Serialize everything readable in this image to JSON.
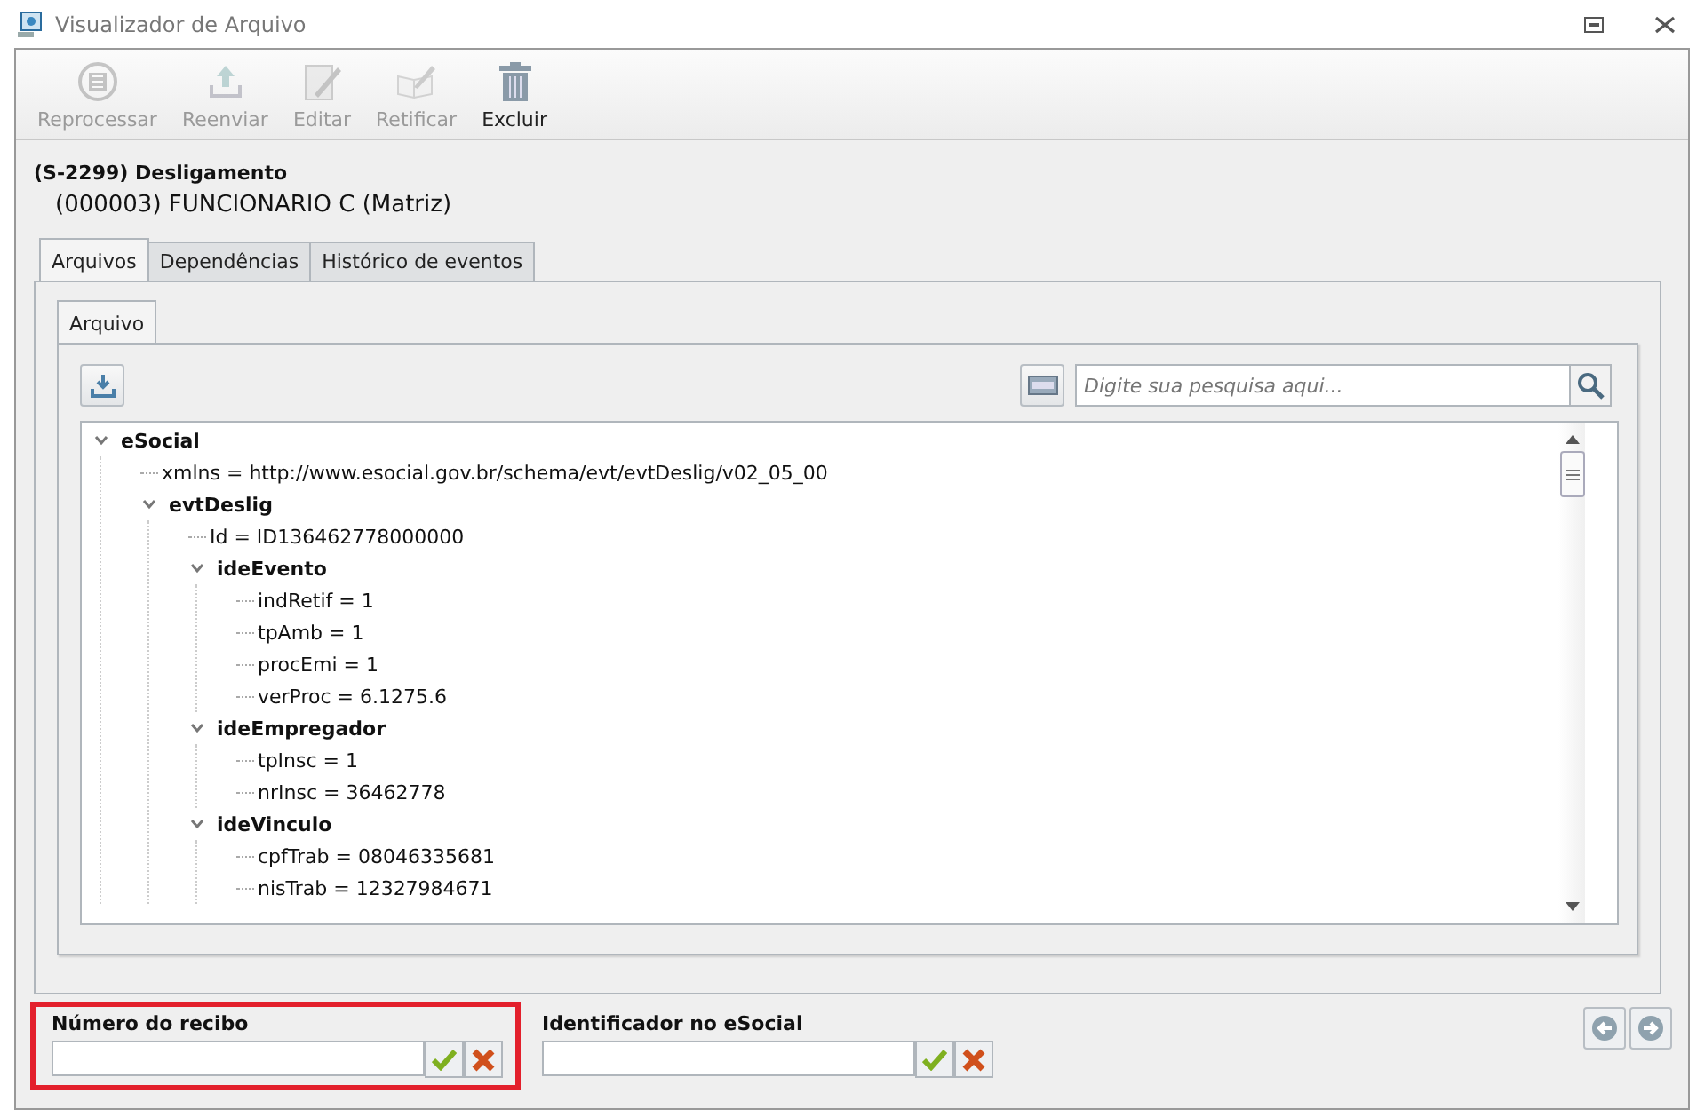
{
  "window": {
    "title": "Visualizador de Arquivo"
  },
  "toolbar": [
    {
      "label": "Reprocessar",
      "disabled": true
    },
    {
      "label": "Reenviar",
      "disabled": true
    },
    {
      "label": "Editar",
      "disabled": true
    },
    {
      "label": "Retificar",
      "disabled": true
    },
    {
      "label": "Excluir",
      "disabled": false
    }
  ],
  "header": {
    "event": "(S-2299) Desligamento",
    "employee": "(000003) FUNCIONARIO C (Matriz)"
  },
  "tabs": [
    {
      "label": "Arquivos",
      "selected": true
    },
    {
      "label": "Dependências",
      "selected": false
    },
    {
      "label": "Histórico de eventos",
      "selected": false
    }
  ],
  "inner_tabs": [
    {
      "label": "Arquivo",
      "selected": true
    }
  ],
  "search": {
    "placeholder": "Digite sua pesquisa aqui..."
  },
  "tree": [
    {
      "text": "eSocial",
      "expanded": true,
      "children": [
        {
          "text": "xmlns = http://www.esocial.gov.br/schema/evt/evtDeslig/v02_05_00"
        },
        {
          "text": "evtDeslig",
          "expanded": true,
          "children": [
            {
              "text": "Id = ID136462778000000"
            },
            {
              "text": "ideEvento",
              "expanded": true,
              "children": [
                {
                  "text": "indRetif = 1"
                },
                {
                  "text": "tpAmb = 1"
                },
                {
                  "text": "procEmi = 1"
                },
                {
                  "text": "verProc = 6.1275.6"
                }
              ]
            },
            {
              "text": "ideEmpregador",
              "expanded": true,
              "children": [
                {
                  "text": "tpInsc = 1"
                },
                {
                  "text": "nrInsc = 36462778"
                }
              ]
            },
            {
              "text": "ideVinculo",
              "expanded": true,
              "children": [
                {
                  "text": "cpfTrab = 08046335681"
                },
                {
                  "text": "nisTrab = 12327984671"
                }
              ]
            }
          ]
        }
      ]
    }
  ],
  "fields": [
    {
      "label": "Número do recibo",
      "highlighted": true
    },
    {
      "label": "Identificador no eSocial",
      "highlighted": false
    }
  ]
}
